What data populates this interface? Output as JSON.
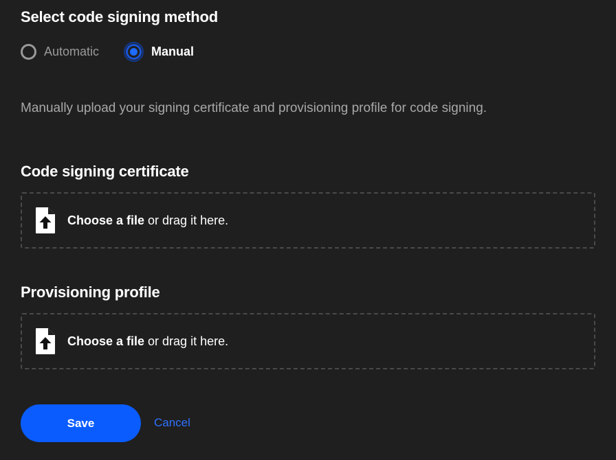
{
  "signing_method": {
    "title": "Select code signing method",
    "options": [
      {
        "label": "Automatic",
        "selected": false
      },
      {
        "label": "Manual",
        "selected": true
      }
    ],
    "description": "Manually upload your signing certificate and provisioning profile for code signing."
  },
  "certificate": {
    "title": "Code signing certificate",
    "dropzone": {
      "choose_label": "Choose a file",
      "drag_label": " or drag it here.",
      "icon": "file-upload-icon"
    }
  },
  "provisioning": {
    "title": "Provisioning profile",
    "dropzone": {
      "choose_label": "Choose a file",
      "drag_label": " or drag it here.",
      "icon": "file-upload-icon"
    }
  },
  "actions": {
    "save_label": "Save",
    "cancel_label": "Cancel"
  },
  "colors": {
    "background": "#1f1f1f",
    "accent": "#0a5cff",
    "link": "#2f72ff",
    "muted_text": "#a8a8a8",
    "dashed_border": "#4a4a4a"
  }
}
